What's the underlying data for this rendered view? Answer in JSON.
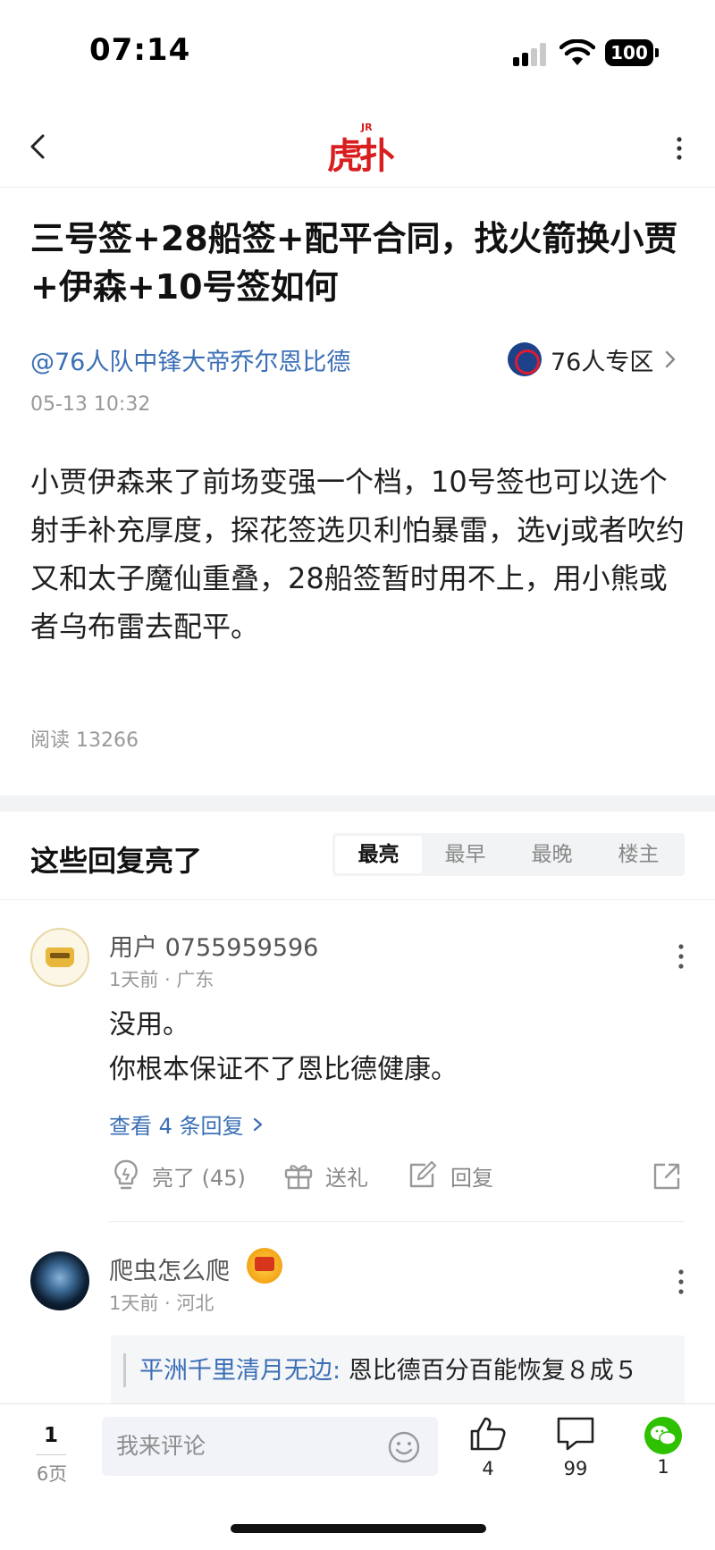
{
  "status_bar": {
    "time": "07:14",
    "battery": "100"
  },
  "nav": {
    "logo_text": "虎扑",
    "logo_superscript": "JR"
  },
  "post": {
    "title": "三号签+28船签+配平合同，找火箭换小贾+伊森+10号签如何",
    "author": "@76人队中锋大帝乔尔恩比德",
    "zone_label": "76人专区",
    "date": "05-13 10:32",
    "body": "小贾伊森来了前场变强一个档，10号签也可以选个射手补充厚度，探花签选贝利怕暴雷，选vj或者吹约又和太子魔仙重叠，28船签暂时用不上，用小熊或者乌布雷去配平。",
    "read_count": "阅读 13266"
  },
  "replies": {
    "title": "这些回复亮了",
    "sort_tabs": [
      "最亮",
      "最早",
      "最晚",
      "楼主"
    ],
    "active_tab": 0
  },
  "comments": [
    {
      "user": "用户 0755959596",
      "meta": "1天前 · 广东",
      "text_lines": [
        "没用。",
        "你根本保证不了恩比德健康。"
      ],
      "view_replies": "查看 4 条回复",
      "actions": {
        "light": "亮了 (45)",
        "gift": "送礼",
        "reply": "回复"
      }
    },
    {
      "user": "爬虫怎么爬",
      "meta": "1天前 · 河北",
      "quote_user": "平洲千里清月无边:",
      "quote_text": " 恩比德百分百能恢复８成５"
    }
  ],
  "bottom_bar": {
    "page_current": "1",
    "page_total": "6页",
    "comment_placeholder": "我来评论",
    "likes": "4",
    "comments_count": "99",
    "shares": "1"
  },
  "colors": {
    "link_blue": "#3b6fb6",
    "brand_red": "#d81e1e",
    "wechat_green": "#2dc100"
  }
}
